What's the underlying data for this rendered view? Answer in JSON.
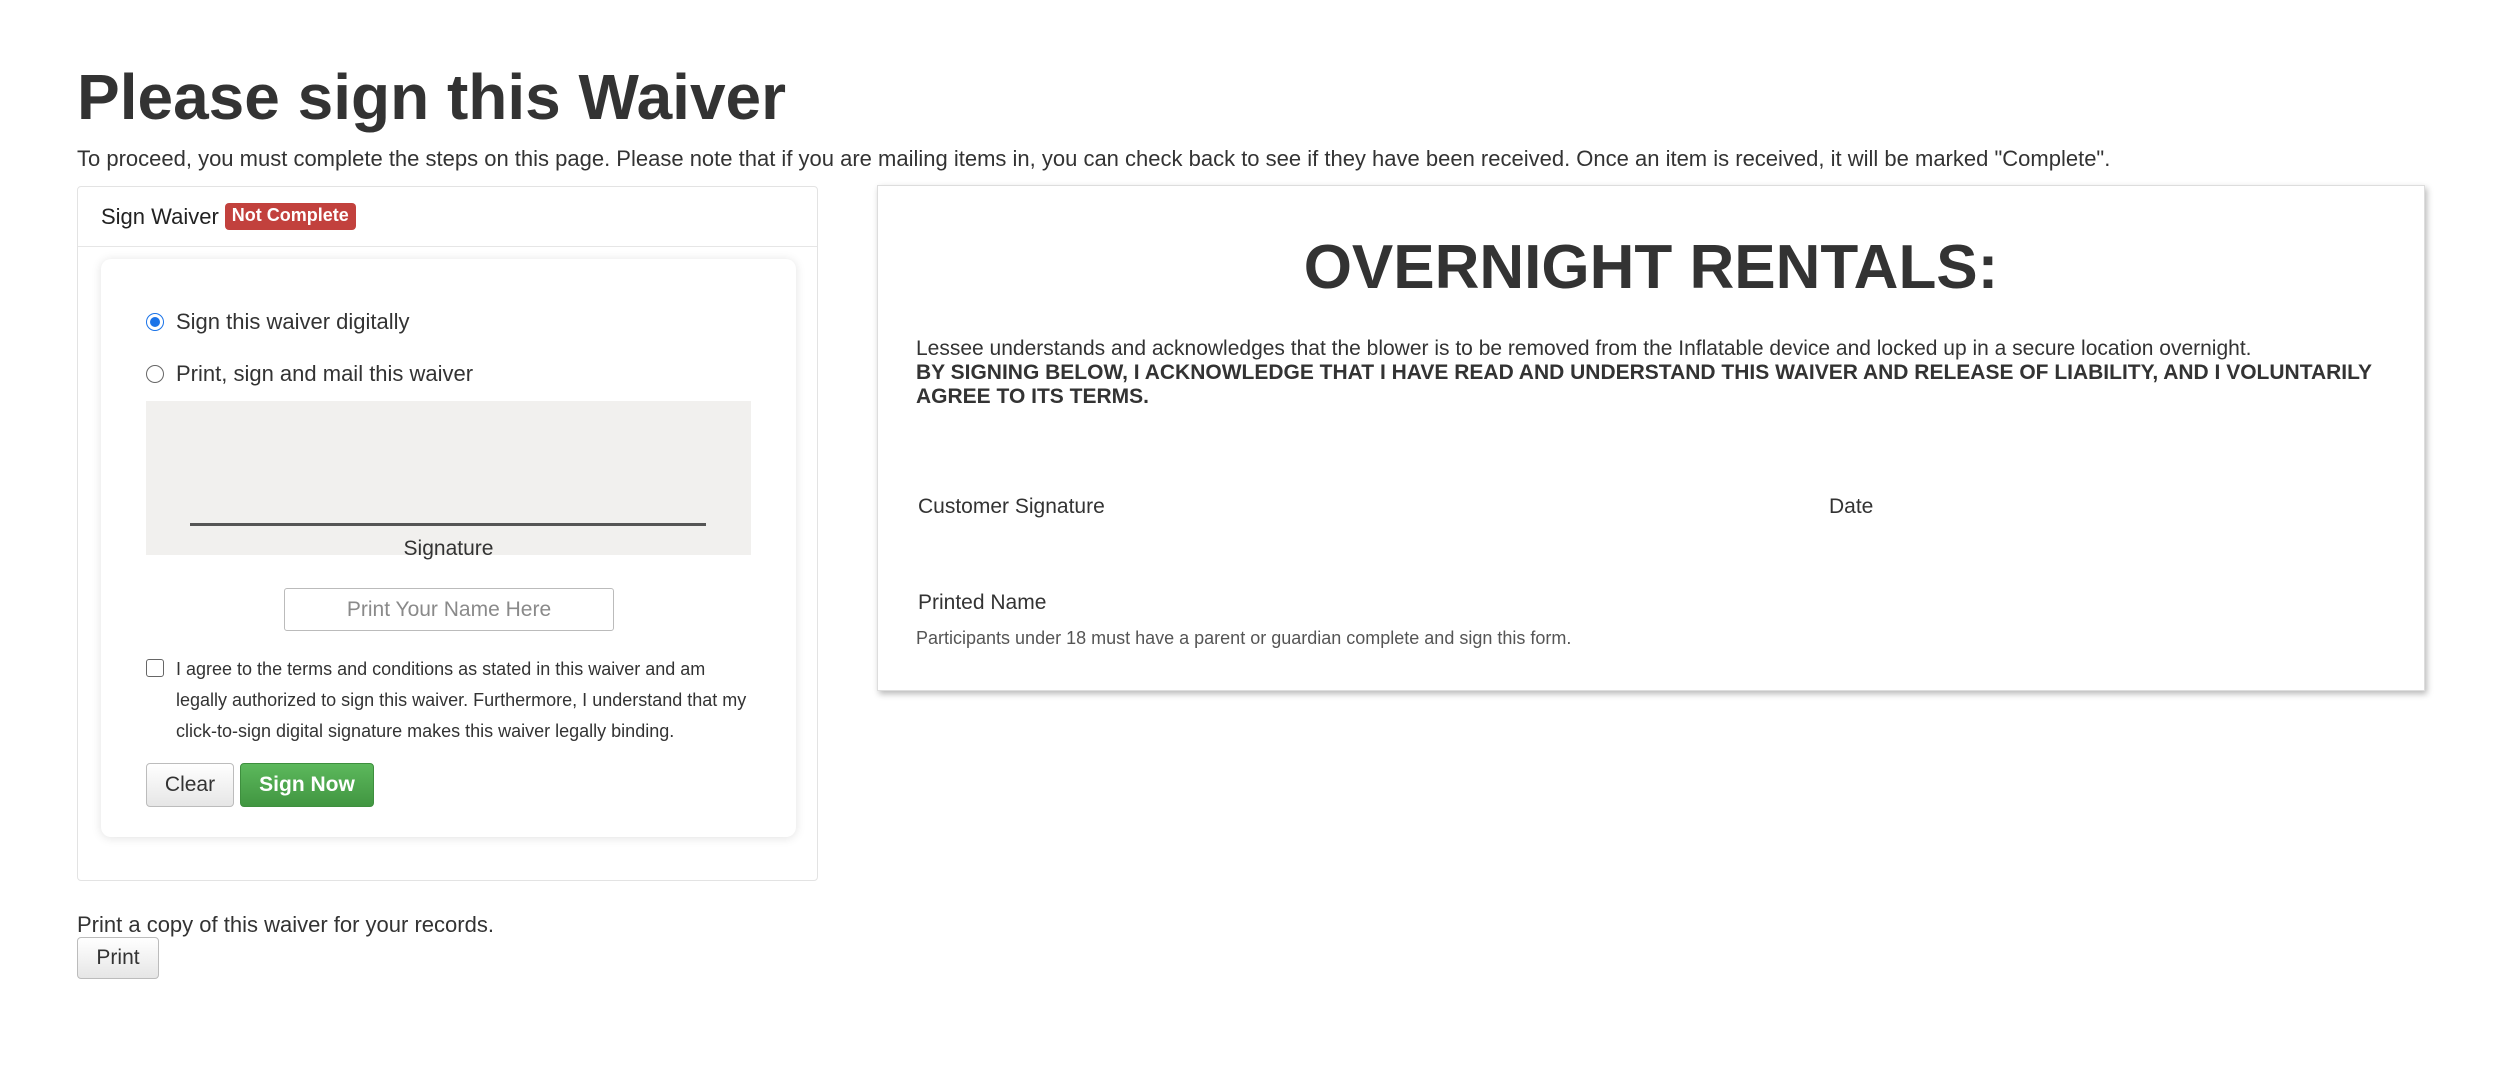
{
  "page": {
    "title": "Please sign this Waiver",
    "intro": "To proceed, you must complete the steps on this page. Please note that if you are mailing items in, you can check back to see if they have been received. Once an item is received, it will be marked \"Complete\"."
  },
  "panel": {
    "heading": "Sign Waiver",
    "status_badge": "Not Complete",
    "options": [
      {
        "label": "Sign this waiver digitally",
        "selected": true
      },
      {
        "label": "Print, sign and mail this waiver",
        "selected": false
      }
    ],
    "signature_label": "Signature",
    "name_input": {
      "placeholder": "Print Your Name Here",
      "value": ""
    },
    "agree_text": "I agree to the terms and conditions as stated in this waiver and am legally authorized to sign this waiver. Furthermore, I understand that my click-to-sign digital signature makes this waiver legally binding.",
    "agree_checked": false,
    "clear_label": "Clear",
    "sign_label": "Sign Now"
  },
  "print": {
    "note": "Print a copy of this waiver for your records.",
    "button_label": "Print"
  },
  "document": {
    "title": "OVERNIGHT RENTALS:",
    "paragraph": "Lessee understands and acknowledges that the blower is to be removed from the Inflatable device and locked up in a secure location overnight.",
    "acknowledgement": "BY SIGNING BELOW, I ACKNOWLEDGE THAT I HAVE READ AND UNDERSTAND THIS WAIVER AND RELEASE OF LIABILITY, AND I VOLUNTARILY AGREE TO ITS TERMS.",
    "customer_signature_label": "Customer Signature",
    "date_label": "Date",
    "printed_name_label": "Printed Name",
    "minors_note": "Participants under 18 must have a parent or guardian complete and sign this form."
  },
  "colors": {
    "badge": "#c2413d",
    "success": "#5cb85c",
    "radio_accent": "#1a73e8",
    "signature_pad": "#f1f0ee"
  }
}
